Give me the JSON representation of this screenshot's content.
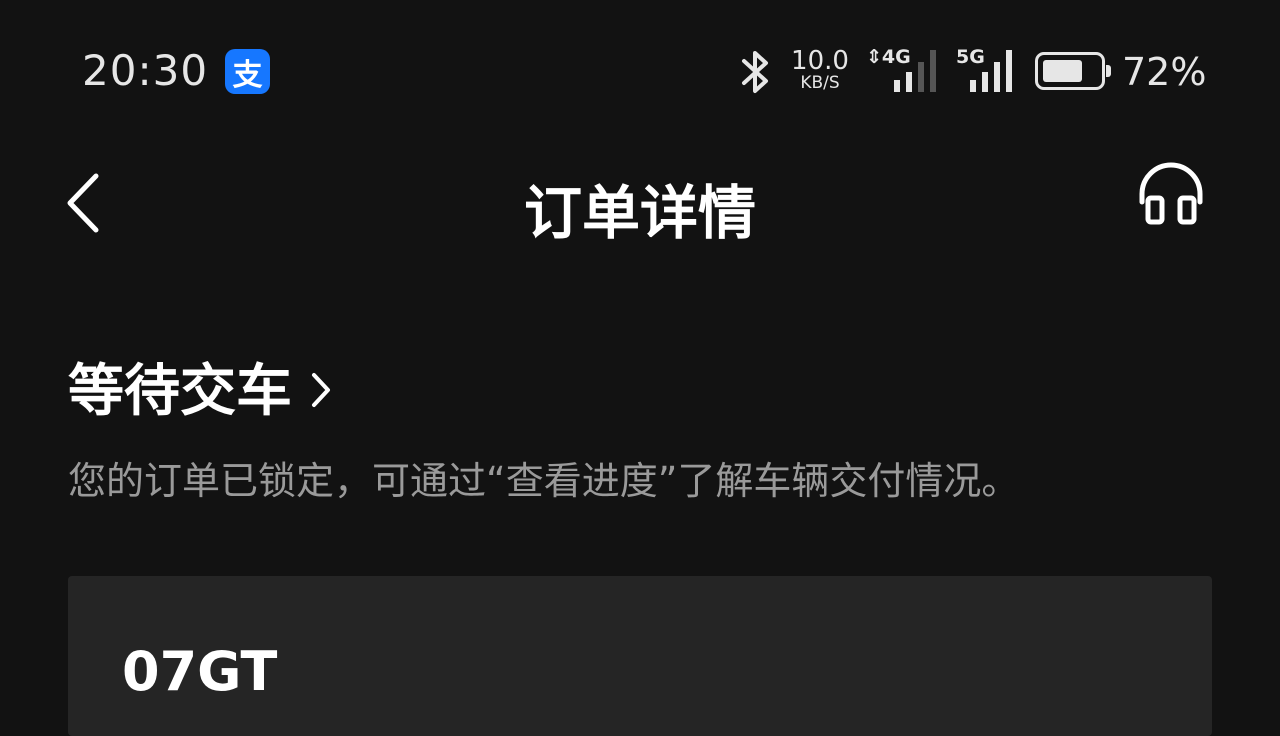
{
  "status_bar": {
    "time": "20:30",
    "app_icon": "alipay-icon",
    "app_icon_glyph": "支",
    "net_speed_value": "10.0",
    "net_speed_unit": "KB/S",
    "sim1_label": "⇕4G",
    "sim2_label": "5G",
    "battery_level": 0.72,
    "battery_text": "72%"
  },
  "header": {
    "title": "订单详情",
    "back_icon": "chevron-left-icon",
    "support_icon": "headset-icon"
  },
  "order": {
    "status_label": "等待交车",
    "status_desc": "您的订单已锁定，可通过“查看进度”了解车辆交付情况。",
    "model": "07GT"
  },
  "colors": {
    "background": "#121212",
    "card": "#252525",
    "secondary_text": "#9a9a9a",
    "alipay_blue": "#1677ff"
  }
}
